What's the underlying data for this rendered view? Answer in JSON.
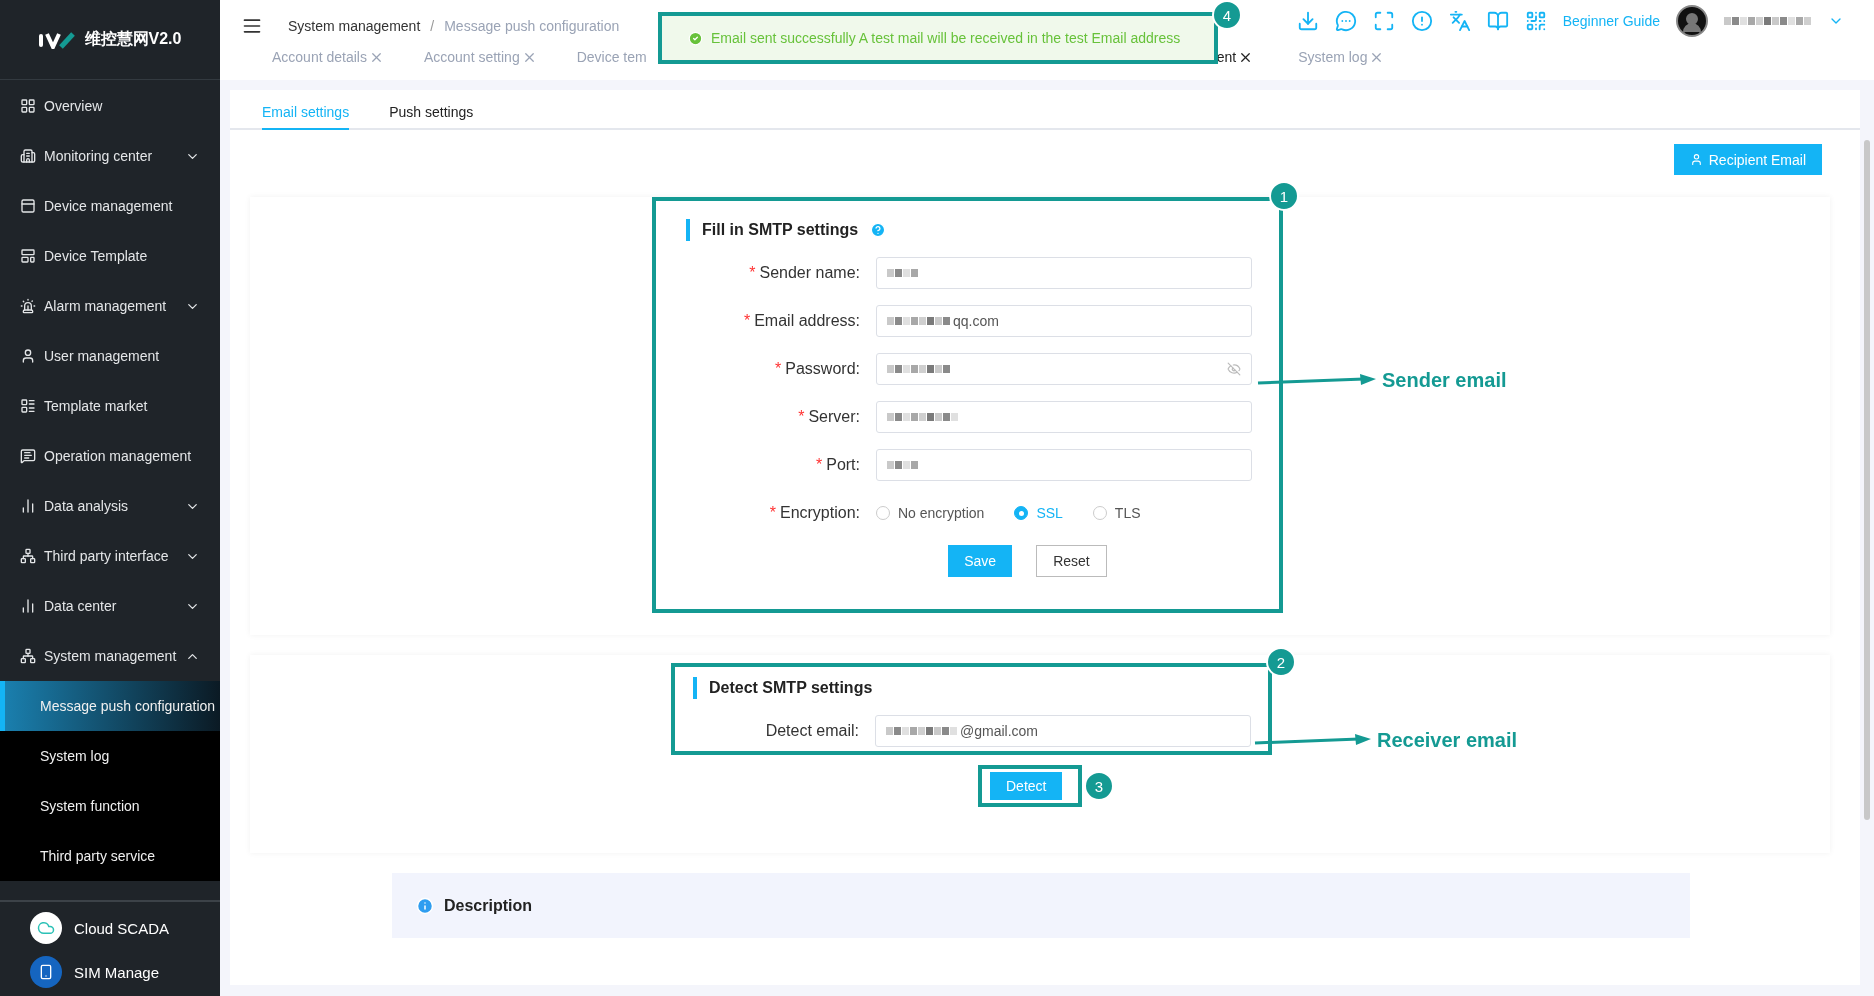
{
  "brand": {
    "name": "维控慧网V2.0"
  },
  "sidebar": {
    "items": [
      {
        "label": "Overview",
        "kind": "link",
        "selected": false
      },
      {
        "label": "Monitoring center",
        "kind": "group",
        "expanded": false,
        "selected": false
      },
      {
        "label": "Device management",
        "kind": "link",
        "selected": false
      },
      {
        "label": "Device Template",
        "kind": "link",
        "selected": false
      },
      {
        "label": "Alarm management",
        "kind": "group",
        "expanded": false,
        "selected": false
      },
      {
        "label": "User management",
        "kind": "link",
        "selected": false
      },
      {
        "label": "Template market",
        "kind": "link",
        "selected": false
      },
      {
        "label": "Operation management",
        "kind": "link",
        "selected": false
      },
      {
        "label": "Data analysis",
        "kind": "group",
        "expanded": false,
        "selected": false
      },
      {
        "label": "Third party interface",
        "kind": "group",
        "expanded": false,
        "selected": false
      },
      {
        "label": "Data center",
        "kind": "group",
        "expanded": false,
        "selected": false
      },
      {
        "label": "System management",
        "kind": "group",
        "expanded": true,
        "selected": false,
        "children": [
          {
            "label": "Message push configuration",
            "selected": true
          },
          {
            "label": "System log",
            "selected": false
          },
          {
            "label": "System function",
            "selected": false
          },
          {
            "label": "Third party service",
            "selected": false
          }
        ]
      }
    ],
    "footer": [
      {
        "label": "Cloud SCADA"
      },
      {
        "label": "SIM Manage"
      }
    ]
  },
  "header": {
    "breadcrumb": [
      "System management",
      "Message push configuration"
    ],
    "separator": "/",
    "page_tabs": [
      {
        "label": "Account details",
        "selected": false
      },
      {
        "label": "Account setting",
        "selected": false
      },
      {
        "label": "Device tem",
        "selected": false,
        "closable": false
      },
      {
        "label": "ent",
        "selected": true
      },
      {
        "label": "System log",
        "selected": false
      }
    ],
    "guide_link": "Beginner Guide"
  },
  "toast": {
    "text": "Email sent successfully A test mail will be received in the test Email address",
    "step": "4"
  },
  "content_tabs": [
    {
      "label": "Email settings",
      "selected": true
    },
    {
      "label": "Push settings",
      "selected": false
    }
  ],
  "recipient_button": "Recipient Email",
  "smtp": {
    "title": "Fill in SMTP settings",
    "step": "1",
    "callout": "Sender email",
    "required_mark": "*",
    "fields": [
      {
        "label": "Sender name:",
        "kind": "text",
        "required": true,
        "redacted": true
      },
      {
        "label": "Email address:",
        "kind": "text",
        "required": true,
        "redacted": true,
        "value": "qq.com"
      },
      {
        "label": "Password:",
        "kind": "password",
        "required": true,
        "redacted": true
      },
      {
        "label": "Server:",
        "kind": "text",
        "required": true,
        "redacted": true
      },
      {
        "label": "Port:",
        "kind": "text",
        "required": true,
        "redacted": true
      },
      {
        "label": "Encryption:",
        "kind": "radio",
        "required": true,
        "options": [
          {
            "label": "No encryption",
            "selected": false
          },
          {
            "label": "SSL",
            "selected": true
          },
          {
            "label": "TLS",
            "selected": false
          }
        ]
      }
    ],
    "buttons": [
      {
        "label": "Save",
        "kind": "primary"
      },
      {
        "label": "Reset",
        "kind": "plain"
      }
    ]
  },
  "detect": {
    "title": "Detect SMTP settings",
    "step": "2",
    "callout": "Receiver email",
    "field": {
      "label": "Detect email:",
      "redacted": true,
      "value": "@gmail.com"
    },
    "button": {
      "label": "Detect",
      "step": "3"
    }
  },
  "description": {
    "title": "Description"
  }
}
